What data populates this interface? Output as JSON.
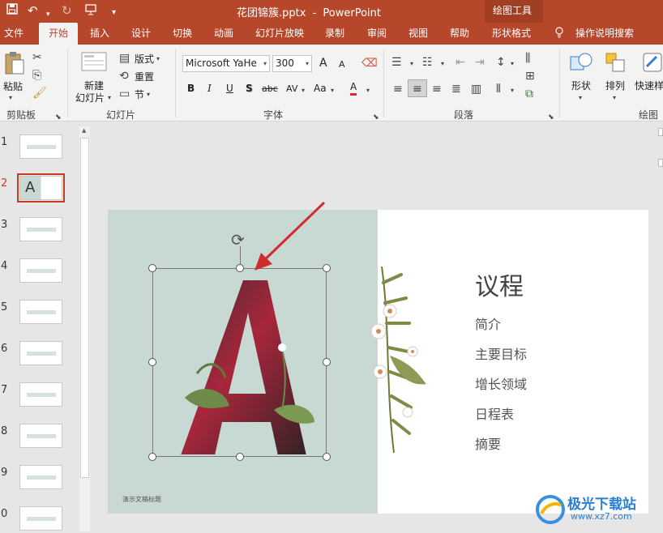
{
  "titlebar": {
    "file_title": "花团锦簇.pptx",
    "separator": "-",
    "app_name": "PowerPoint",
    "context_tool_group": "绘图工具"
  },
  "tabs": [
    "文件",
    "开始",
    "插入",
    "设计",
    "切换",
    "动画",
    "幻灯片放映",
    "录制",
    "审阅",
    "视图",
    "帮助",
    "形状格式"
  ],
  "active_tab": "开始",
  "tell_me": "操作说明搜索",
  "ribbon": {
    "clipboard": {
      "paste": "粘贴",
      "group": "剪贴板"
    },
    "slides": {
      "new_slide_line1": "新建",
      "new_slide_line2": "幻灯片",
      "layout": "版式",
      "reset": "重置",
      "section": "节",
      "group": "幻灯片"
    },
    "font": {
      "font_name": "Microsoft YaHe",
      "font_size": "300",
      "group": "字体",
      "bold": "B",
      "italic": "I",
      "underline": "U",
      "shadow": "S",
      "strike": "abc",
      "spacing": "AV",
      "case": "Aa",
      "color": "A",
      "grow": "A",
      "shrink": "A"
    },
    "paragraph": {
      "group": "段落"
    },
    "drawing": {
      "shape": "形状",
      "arrange": "排列",
      "quick_style": "快速样",
      "group": "绘图"
    }
  },
  "colors": {
    "accent": "#b7472a",
    "slide_left_bg": "#c8d9d4",
    "selection_outline": "#c43e1c",
    "arrow": "#d22b2b"
  },
  "thumbnails": [
    "1",
    "2",
    "3",
    "4",
    "5",
    "6",
    "7",
    "8",
    "9",
    "0"
  ],
  "selected_slide": "2",
  "slide": {
    "big_letter": "A",
    "heading": "议程",
    "items": [
      "简介",
      "主要目标",
      "增长领域",
      "日程表",
      "摘要"
    ],
    "footer": "演示文稿标题"
  },
  "icons": {
    "save": "save-icon",
    "undo": "undo-icon",
    "redo": "redo-icon",
    "present": "present-from-start-icon",
    "customize": "customize-qat-icon",
    "lightbulb": "lightbulb-icon",
    "rotate": "rotate-handle-icon"
  },
  "watermark": {
    "text": "极光下载站",
    "url": "www.xz7.com"
  }
}
